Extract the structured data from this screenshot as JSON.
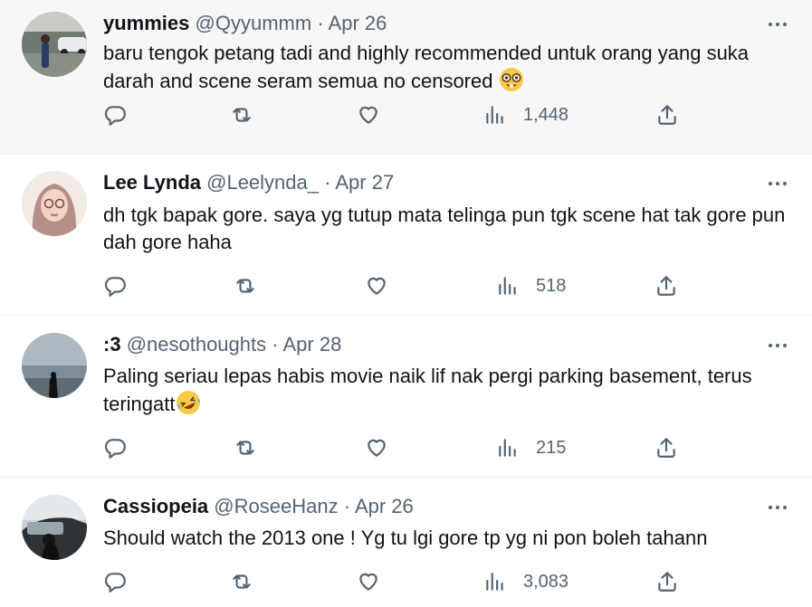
{
  "replies": [
    {
      "display_name": "yummies",
      "handle": "@Qyyummm",
      "separator": "·",
      "date": "Apr 26",
      "text": "baru tengok petang tadi and highly recommended untuk orang yang suka darah and scene seram semua no censored",
      "emoji": "nerd-face",
      "views": "1,448",
      "avatar": "avatar-photo-person-by-car",
      "highlighted": true
    },
    {
      "display_name": "Lee Lynda",
      "handle": "@Leelynda_",
      "separator": "·",
      "date": "Apr 27",
      "text": "dh tgk bapak gore. saya yg tutup mata telinga pun tgk scene hat tak gore pun dah gore haha",
      "views": "518",
      "avatar": "avatar-photo-woman-hijab",
      "highlighted": false
    },
    {
      "display_name": ":3",
      "handle": "@nesothoughts",
      "separator": "·",
      "date": "Apr 28",
      "text": "Paling seriau lepas habis movie naik lif nak pergi parking basement, terus teringatt",
      "emoji": "rolling-on-floor-laughing",
      "views": "215",
      "avatar": "avatar-photo-seaside-silhouette",
      "highlighted": false
    },
    {
      "display_name": "Cassiopeia",
      "handle": "@RoseeHanz",
      "separator": "·",
      "date": "Apr 26",
      "text": "Should watch the 2013 one ! Yg tu lgi gore tp yg ni pon boleh tahann",
      "views": "3,083",
      "avatar": "avatar-photo-person-in-car",
      "highlighted": false
    }
  ],
  "icons": {
    "reply": "reply-icon",
    "retweet": "retweet-icon",
    "like": "like-icon",
    "views": "views-icon",
    "share": "share-icon",
    "more": "more-icon"
  },
  "colors": {
    "text": "#0f1419",
    "muted": "#536471",
    "divider": "#eff3f4",
    "highlight_bg": "#f7f7f7"
  }
}
